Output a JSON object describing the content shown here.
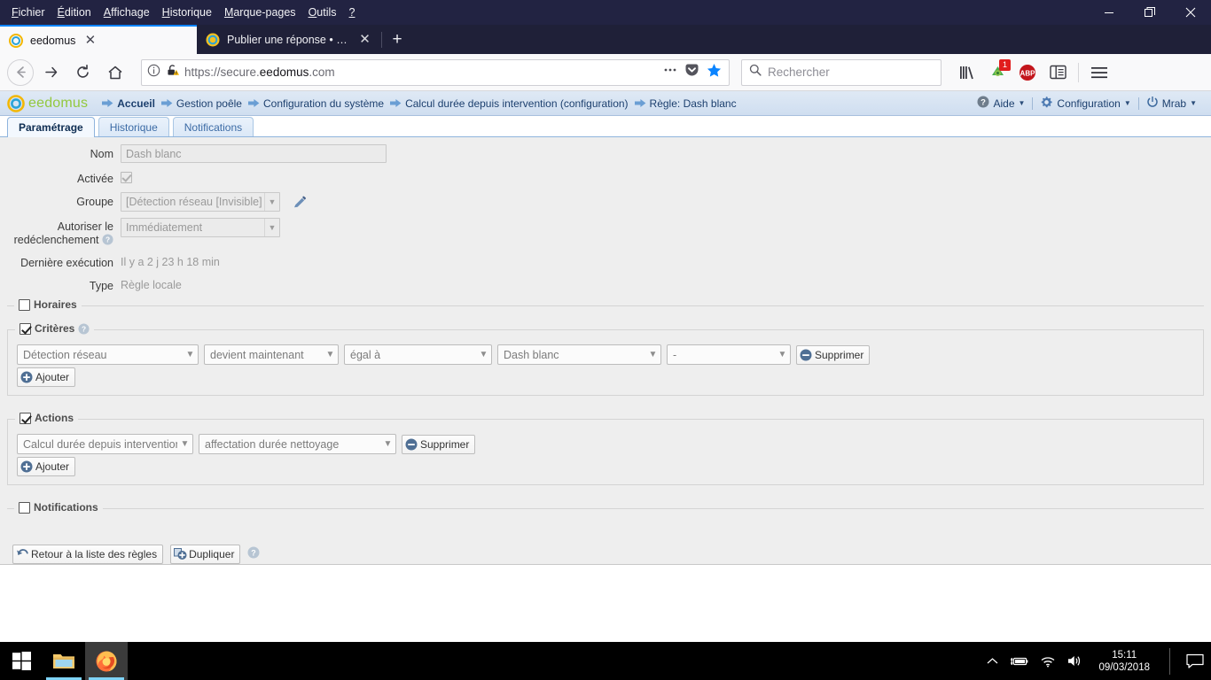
{
  "browser": {
    "menubar": [
      {
        "pre": "F",
        "mid": "ichier",
        "post": ""
      },
      {
        "pre": "É",
        "mid": "dition",
        "post": ""
      },
      {
        "pre": "A",
        "mid": "ffichage",
        "post": ""
      },
      {
        "pre": "H",
        "mid": "istorique",
        "post": ""
      },
      {
        "pre": "M",
        "mid": "arque-pages",
        "post": ""
      },
      {
        "pre": "O",
        "mid": "utils",
        "post": ""
      },
      {
        "pre": "?",
        "mid": "",
        "post": ""
      }
    ],
    "menu_labels": [
      "Fichier",
      "Édition",
      "Affichage",
      "Historique",
      "Marque-pages",
      "Outils",
      "?"
    ],
    "window_controls": {
      "minimize": "minimize",
      "maximize": "maximize",
      "close": "close"
    },
    "tabs": [
      {
        "title": "eedomus",
        "active": true
      },
      {
        "title": "Publier une réponse • Forum ee",
        "active": false
      }
    ],
    "new_tab_label": "+",
    "url": {
      "prefix": "https://secure.",
      "host": "eedomus",
      "suffix": ".com"
    },
    "url_full": "https://secure.eedomus.com",
    "search_placeholder": "Rechercher",
    "extension_badge": "1",
    "toolbar_icons": [
      "library-icon",
      "extension-icon",
      "adblock-plus-icon",
      "sidebar-icon",
      "hamburger-menu-icon"
    ]
  },
  "ee": {
    "logo_text": "eedomus",
    "breadcrumbs": [
      "Accueil",
      "Gestion poêle",
      "Configuration du système",
      "Calcul durée depuis intervention (configuration)",
      "Règle: Dash blanc"
    ],
    "header_right": [
      {
        "label": "Aide",
        "icon": "help-icon"
      },
      {
        "label": "Configuration",
        "icon": "gear-icon"
      },
      {
        "label": "Mrab",
        "icon": "power-icon"
      }
    ],
    "tabs": [
      {
        "label": "Paramétrage",
        "active": true
      },
      {
        "label": "Historique",
        "active": false
      },
      {
        "label": "Notifications",
        "active": false
      }
    ],
    "form": {
      "nom": {
        "label": "Nom",
        "value": "Dash blanc"
      },
      "activee": {
        "label": "Activée",
        "checked": true
      },
      "groupe": {
        "label": "Groupe",
        "value": "[Détection réseau [Invisible]"
      },
      "redeclenchement": {
        "label_line1": "Autoriser le",
        "label_line2": "redéclenchement",
        "value": "Immédiatement"
      },
      "derniere_execution": {
        "label": "Dernière exécution",
        "value": "Il y a 2 j 23 h 18 min"
      },
      "type": {
        "label": "Type",
        "value": "Règle locale"
      }
    },
    "sections": {
      "horaires": {
        "legend": "Horaires",
        "checked": false
      },
      "criteres": {
        "legend": "Critères",
        "checked": true,
        "rows": [
          {
            "device": "Détection réseau",
            "operator": "devient maintenant",
            "comparator": "égal à",
            "value": "Dash blanc",
            "extra": "-",
            "delete_label": "Supprimer"
          }
        ],
        "add_label": "Ajouter"
      },
      "actions": {
        "legend": "Actions",
        "checked": true,
        "rows": [
          {
            "device": "Calcul durée depuis intervention",
            "action": "affectation durée nettoyage",
            "delete_label": "Supprimer"
          }
        ],
        "add_label": "Ajouter"
      },
      "notifications": {
        "legend": "Notifications",
        "checked": false
      }
    },
    "footer": {
      "back_label": "Retour à la liste des règles",
      "duplicate_label": "Dupliquer",
      "help_icon": "help-icon"
    }
  },
  "taskbar": {
    "start": "windows-start-icon",
    "apps": [
      {
        "name": "file-explorer-icon",
        "active": false
      },
      {
        "name": "firefox-icon",
        "active": true
      }
    ],
    "tray_icons": [
      "chevron-up-icon",
      "battery-icon",
      "wifi-icon",
      "volume-icon"
    ],
    "time": "15:11",
    "date": "09/03/2018",
    "action_center": "notification-icon"
  },
  "colors": {
    "titlebar": "#222342",
    "accent_tab": "#0a84ff",
    "ee_green": "#93c83e",
    "ee_blue": "#1c3f6e",
    "content_bg": "#eeeeee",
    "badge_red": "#e11d1d"
  }
}
